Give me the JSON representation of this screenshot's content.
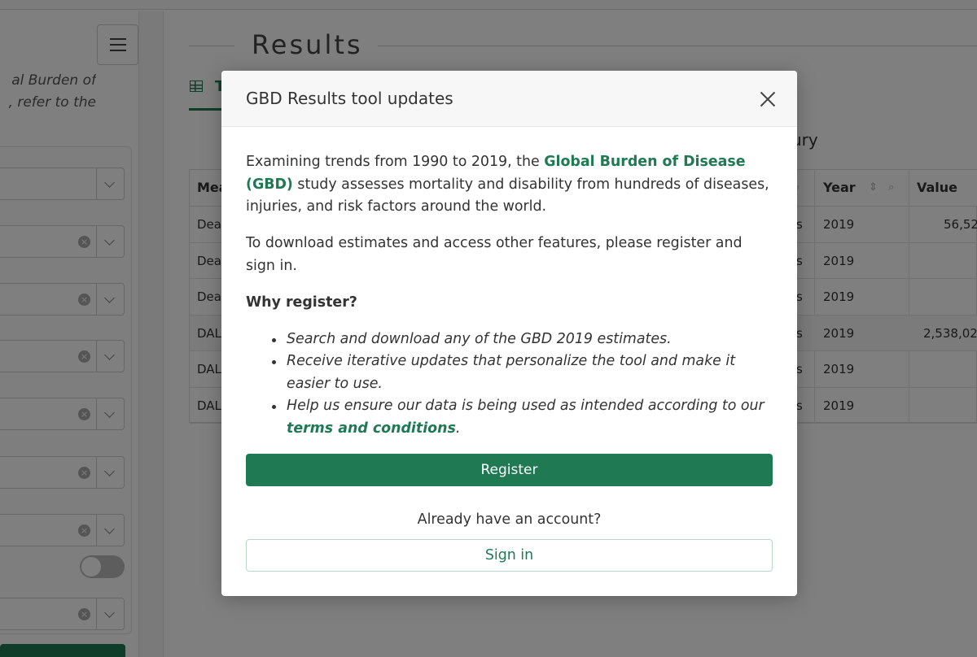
{
  "sidebar": {
    "intro_line1": "al Burden of",
    "intro_line2": ", refer to the"
  },
  "main": {
    "results_title": "Results",
    "tab_label": "T",
    "cause_label": "ury",
    "table": {
      "headers": {
        "measure": "Mea",
        "year": "Year",
        "value": "Value"
      },
      "rows": [
        {
          "measure": "Dea",
          "metric": "s",
          "year": "2019",
          "value": "56,52"
        },
        {
          "measure": "Dea",
          "metric": "s",
          "year": "2019",
          "value": ""
        },
        {
          "measure": "Dea",
          "metric": "s",
          "year": "2019",
          "value": ""
        },
        {
          "measure": "DAL",
          "metric": "s",
          "year": "2019",
          "value": "2,538,02"
        },
        {
          "measure": "DAL",
          "metric": "s",
          "year": "2019",
          "value": ""
        },
        {
          "measure": "DAL",
          "metric": "s",
          "year": "2019",
          "value": ""
        }
      ]
    }
  },
  "modal": {
    "title": "GBD Results tool updates",
    "intro_pre": "Examining trends from 1990 to 2019, the ",
    "intro_link": "Global Burden of Disease (GBD)",
    "intro_post": " study assesses mortality and disability from hundreds of diseases, injuries, and risk factors around the world.",
    "download_text": "To download estimates and access other features, please register and sign in.",
    "why_heading": "Why register?",
    "bullets": [
      "Search and download any of the GBD 2019 estimates.",
      "Receive iterative updates that personalize the tool and make it easier to use.",
      "Help us ensure our data is being used as intended according to our "
    ],
    "terms_link": "terms and conditions",
    "terms_suffix": ".",
    "register_label": "Register",
    "already_text": "Already have an account?",
    "signin_label": "Sign in"
  },
  "colors": {
    "accent": "#1f7a54",
    "overlay": "rgba(0,0,0,0.5)"
  }
}
